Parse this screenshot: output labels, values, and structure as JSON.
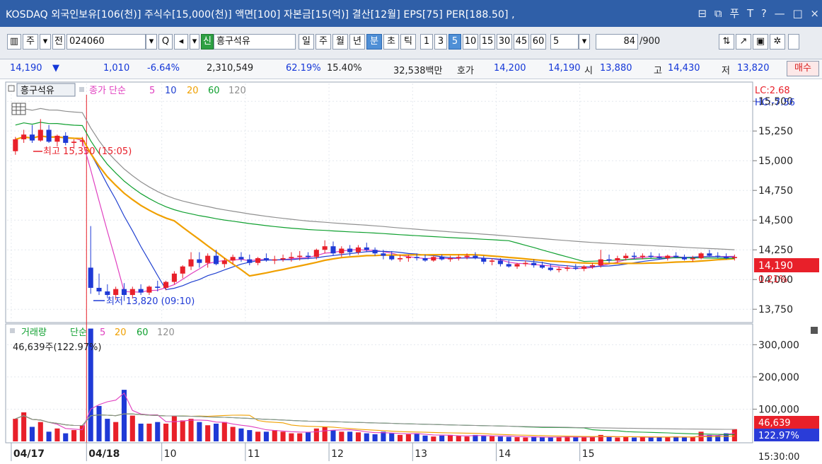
{
  "title_bar": {
    "text": "KOSDAQ 외국인보유[106(천)] 주식수[15,000(천)] 액면[100] 자본금[15(억)] 결산[12월] EPS[75] PER[188.50] ,",
    "icons": [
      "restore-icon",
      "copy-icon",
      "pin-icon",
      "font-icon",
      "help-icon",
      "minimize-icon",
      "maximize-icon",
      "close-icon"
    ],
    "glyphs": [
      "⊟",
      "⧉",
      "푸",
      "T",
      "?",
      "—",
      "□",
      "×"
    ]
  },
  "toolbar": {
    "mode_label": "주",
    "sel_label": "전",
    "code": "024060",
    "search_glyph": "Q",
    "new_badge": "신",
    "stock_name": "흥구석유",
    "periods": [
      "일",
      "주",
      "월",
      "년",
      "분",
      "초",
      "틱"
    ],
    "active_period": "분",
    "intervals": [
      "1",
      "3",
      "5",
      "10",
      "15",
      "30",
      "45",
      "60"
    ],
    "active_interval": "5",
    "custom_interval": "5",
    "count_value": "84",
    "count_total": "/900"
  },
  "quote": {
    "price": "14,190",
    "arrow": "▼",
    "change": "1,010",
    "change_pct": "-6.64%",
    "volume": "2,310,549",
    "ratio1": "62.19%",
    "ratio2": "15.40%",
    "amount": "32,538백만",
    "hoga_label": "호가",
    "ask": "14,200",
    "bid": "14,190",
    "open_label": "시",
    "open": "13,880",
    "high_label": "고",
    "high": "14,430",
    "low_label": "저",
    "low": "13,820",
    "buy_label": "매수"
  },
  "price_panel": {
    "legend_name": "흥구석유",
    "legend_ma": "종가 단순",
    "ma_periods": [
      "5",
      "10",
      "20",
      "60",
      "120"
    ],
    "ma_colors": [
      "#e040c0",
      "#2040d0",
      "#f0a000",
      "#10a030",
      "#909090"
    ],
    "lc_text": "LC:2.68",
    "hc_text": "HC:-7.56",
    "max_note": "최고 15,350 (15:05)",
    "min_note": "최저 13,820 (09:10)",
    "current_price": "14,190",
    "current_pct": "0.21%",
    "y_ticks": [
      "15,500",
      "15,250",
      "15,000",
      "14,750",
      "14,500",
      "14,250",
      "14,000",
      "13,750"
    ],
    "y_values": [
      15500,
      15250,
      15000,
      14750,
      14500,
      14250,
      14000,
      13750
    ],
    "up_color": "#e8202a",
    "down_color": "#1f3ad6"
  },
  "volume_panel": {
    "legend_name": "거래량",
    "legend_ma": "단순",
    "ma_periods": [
      "5",
      "20",
      "60",
      "120"
    ],
    "ma_colors": [
      "#e040c0",
      "#f0a000",
      "#10a030",
      "#909090"
    ],
    "current_note": "46,639주(122.97%)",
    "current_volume": "46,639",
    "current_pct": "122.97%",
    "y_ticks": [
      "300,000",
      "200,000",
      "100,000"
    ],
    "y_values": [
      300000,
      200000,
      100000
    ]
  },
  "x_axis": {
    "labels": [
      "04/17",
      "04/18",
      "10",
      "11",
      "12",
      "13",
      "14",
      "15"
    ],
    "last_time": "15:30:00"
  },
  "chart_data": {
    "type": "candlestick",
    "interval": "5분",
    "candles": [
      {
        "o": 15080,
        "h": 15200,
        "l": 15050,
        "c": 15180
      },
      {
        "o": 15180,
        "h": 15260,
        "l": 15150,
        "c": 15220
      },
      {
        "o": 15220,
        "h": 15300,
        "l": 15150,
        "c": 15170
      },
      {
        "o": 15170,
        "h": 15350,
        "l": 15160,
        "c": 15260
      },
      {
        "o": 15260,
        "h": 15300,
        "l": 15150,
        "c": 15160
      },
      {
        "o": 15160,
        "h": 15220,
        "l": 15120,
        "c": 15210
      },
      {
        "o": 15210,
        "h": 15240,
        "l": 15130,
        "c": 15150
      },
      {
        "o": 15150,
        "h": 15180,
        "l": 15100,
        "c": 15160
      },
      {
        "o": 15160,
        "h": 15200,
        "l": 15120,
        "c": 15170
      },
      {
        "o": 14100,
        "h": 14450,
        "l": 13880,
        "c": 13930
      },
      {
        "o": 13930,
        "h": 14050,
        "l": 13870,
        "c": 13900
      },
      {
        "o": 13900,
        "h": 13960,
        "l": 13850,
        "c": 13870
      },
      {
        "o": 13870,
        "h": 13940,
        "l": 13830,
        "c": 13920
      },
      {
        "o": 13920,
        "h": 13970,
        "l": 13820,
        "c": 13870
      },
      {
        "o": 13870,
        "h": 13940,
        "l": 13840,
        "c": 13920
      },
      {
        "o": 13920,
        "h": 13960,
        "l": 13870,
        "c": 13890
      },
      {
        "o": 13890,
        "h": 13950,
        "l": 13870,
        "c": 13940
      },
      {
        "o": 13940,
        "h": 13990,
        "l": 13900,
        "c": 13930
      },
      {
        "o": 13930,
        "h": 13990,
        "l": 13910,
        "c": 13980
      },
      {
        "o": 13980,
        "h": 14070,
        "l": 13960,
        "c": 14050
      },
      {
        "o": 14050,
        "h": 14120,
        "l": 14010,
        "c": 14110
      },
      {
        "o": 14110,
        "h": 14230,
        "l": 14080,
        "c": 14170
      },
      {
        "o": 14170,
        "h": 14230,
        "l": 14100,
        "c": 14140
      },
      {
        "o": 14140,
        "h": 14220,
        "l": 14100,
        "c": 14200
      },
      {
        "o": 14200,
        "h": 14250,
        "l": 14120,
        "c": 14130
      },
      {
        "o": 14130,
        "h": 14180,
        "l": 14100,
        "c": 14160
      },
      {
        "o": 14160,
        "h": 14210,
        "l": 14130,
        "c": 14190
      },
      {
        "o": 14190,
        "h": 14230,
        "l": 14150,
        "c": 14170
      },
      {
        "o": 14170,
        "h": 14210,
        "l": 14120,
        "c": 14140
      },
      {
        "o": 14140,
        "h": 14190,
        "l": 14120,
        "c": 14180
      },
      {
        "o": 14180,
        "h": 14220,
        "l": 14150,
        "c": 14160
      },
      {
        "o": 14160,
        "h": 14200,
        "l": 14130,
        "c": 14170
      },
      {
        "o": 14170,
        "h": 14210,
        "l": 14150,
        "c": 14180
      },
      {
        "o": 14180,
        "h": 14230,
        "l": 14150,
        "c": 14190
      },
      {
        "o": 14190,
        "h": 14240,
        "l": 14160,
        "c": 14200
      },
      {
        "o": 14200,
        "h": 14230,
        "l": 14170,
        "c": 14190
      },
      {
        "o": 14190,
        "h": 14260,
        "l": 14170,
        "c": 14250
      },
      {
        "o": 14250,
        "h": 14330,
        "l": 14220,
        "c": 14280
      },
      {
        "o": 14280,
        "h": 14320,
        "l": 14200,
        "c": 14220
      },
      {
        "o": 14220,
        "h": 14280,
        "l": 14190,
        "c": 14260
      },
      {
        "o": 14260,
        "h": 14290,
        "l": 14200,
        "c": 14230
      },
      {
        "o": 14230,
        "h": 14290,
        "l": 14210,
        "c": 14270
      },
      {
        "o": 14270,
        "h": 14310,
        "l": 14230,
        "c": 14250
      },
      {
        "o": 14250,
        "h": 14270,
        "l": 14200,
        "c": 14220
      },
      {
        "o": 14220,
        "h": 14250,
        "l": 14170,
        "c": 14200
      },
      {
        "o": 14200,
        "h": 14240,
        "l": 14160,
        "c": 14170
      },
      {
        "o": 14170,
        "h": 14210,
        "l": 14150,
        "c": 14180
      },
      {
        "o": 14180,
        "h": 14210,
        "l": 14150,
        "c": 14190
      },
      {
        "o": 14190,
        "h": 14220,
        "l": 14160,
        "c": 14180
      },
      {
        "o": 14180,
        "h": 14210,
        "l": 14150,
        "c": 14160
      },
      {
        "o": 14160,
        "h": 14200,
        "l": 14150,
        "c": 14190
      },
      {
        "o": 14190,
        "h": 14210,
        "l": 14160,
        "c": 14170
      },
      {
        "o": 14170,
        "h": 14200,
        "l": 14150,
        "c": 14180
      },
      {
        "o": 14180,
        "h": 14210,
        "l": 14160,
        "c": 14190
      },
      {
        "o": 14190,
        "h": 14220,
        "l": 14170,
        "c": 14200
      },
      {
        "o": 14200,
        "h": 14230,
        "l": 14170,
        "c": 14180
      },
      {
        "o": 14180,
        "h": 14200,
        "l": 14130,
        "c": 14150
      },
      {
        "o": 14150,
        "h": 14180,
        "l": 14120,
        "c": 14160
      },
      {
        "o": 14160,
        "h": 14180,
        "l": 14110,
        "c": 14130
      },
      {
        "o": 14130,
        "h": 14160,
        "l": 14100,
        "c": 14110
      },
      {
        "o": 14110,
        "h": 14140,
        "l": 14090,
        "c": 14130
      },
      {
        "o": 14130,
        "h": 14160,
        "l": 14110,
        "c": 14140
      },
      {
        "o": 14140,
        "h": 14170,
        "l": 14100,
        "c": 14120
      },
      {
        "o": 14120,
        "h": 14150,
        "l": 14090,
        "c": 14100
      },
      {
        "o": 14100,
        "h": 14130,
        "l": 14070,
        "c": 14080
      },
      {
        "o": 14080,
        "h": 14110,
        "l": 14060,
        "c": 14090
      },
      {
        "o": 14090,
        "h": 14120,
        "l": 14070,
        "c": 14100
      },
      {
        "o": 14100,
        "h": 14130,
        "l": 14080,
        "c": 14090
      },
      {
        "o": 14090,
        "h": 14120,
        "l": 14070,
        "c": 14110
      },
      {
        "o": 14110,
        "h": 14140,
        "l": 14090,
        "c": 14120
      },
      {
        "o": 14120,
        "h": 14250,
        "l": 14100,
        "c": 14170
      },
      {
        "o": 14170,
        "h": 14210,
        "l": 14140,
        "c": 14160
      },
      {
        "o": 14160,
        "h": 14200,
        "l": 14140,
        "c": 14180
      },
      {
        "o": 14180,
        "h": 14220,
        "l": 14160,
        "c": 14200
      },
      {
        "o": 14200,
        "h": 14230,
        "l": 14170,
        "c": 14190
      },
      {
        "o": 14190,
        "h": 14220,
        "l": 14170,
        "c": 14200
      },
      {
        "o": 14200,
        "h": 14230,
        "l": 14180,
        "c": 14190
      },
      {
        "o": 14190,
        "h": 14220,
        "l": 14170,
        "c": 14180
      },
      {
        "o": 14180,
        "h": 14210,
        "l": 14160,
        "c": 14200
      },
      {
        "o": 14200,
        "h": 14230,
        "l": 14180,
        "c": 14190
      },
      {
        "o": 14190,
        "h": 14210,
        "l": 14160,
        "c": 14170
      },
      {
        "o": 14170,
        "h": 14200,
        "l": 14150,
        "c": 14180
      },
      {
        "o": 14180,
        "h": 14230,
        "l": 14170,
        "c": 14220
      },
      {
        "o": 14220,
        "h": 14250,
        "l": 14190,
        "c": 14200
      },
      {
        "o": 14200,
        "h": 14230,
        "l": 14180,
        "c": 14190
      },
      {
        "o": 14190,
        "h": 14220,
        "l": 14170,
        "c": 14180
      },
      {
        "o": 14180,
        "h": 14210,
        "l": 14160,
        "c": 14190
      }
    ],
    "volumes": [
      70000,
      90000,
      45000,
      60000,
      30000,
      40000,
      25000,
      35000,
      50000,
      350000,
      110000,
      70000,
      60000,
      160000,
      80000,
      55000,
      55000,
      60000,
      55000,
      80000,
      65000,
      70000,
      60000,
      50000,
      55000,
      60000,
      45000,
      40000,
      35000,
      30000,
      30000,
      35000,
      30000,
      25000,
      25000,
      28000,
      40000,
      45000,
      35000,
      30000,
      30000,
      28000,
      25000,
      22000,
      30000,
      25000,
      20000,
      22000,
      25000,
      18000,
      15000,
      18000,
      20000,
      17000,
      15000,
      20000,
      18000,
      16000,
      15000,
      14000,
      13000,
      12000,
      15000,
      13000,
      12000,
      14000,
      15000,
      13000,
      12000,
      13000,
      20000,
      14000,
      12000,
      13000,
      12000,
      15000,
      12000,
      14000,
      13000,
      15000,
      12000,
      13000,
      30000,
      20000,
      18000,
      25000,
      38000
    ],
    "x_labels": [
      "04/17",
      "04/18",
      "10",
      "11",
      "12",
      "13",
      "14",
      "15"
    ],
    "y_range_price": [
      13650,
      15650
    ],
    "y_range_volume": [
      0,
      360000
    ]
  }
}
